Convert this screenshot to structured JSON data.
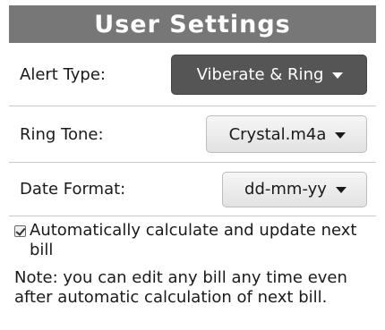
{
  "header": {
    "title": "User Settings"
  },
  "settings": {
    "alert_type": {
      "label": "Alert Type:",
      "value": "Viberate & Ring"
    },
    "ring_tone": {
      "label": "Ring Tone:",
      "value": "Crystal.m4a"
    },
    "date_format": {
      "label": "Date Format:",
      "value": "dd-mm-yy"
    }
  },
  "auto_calculate": {
    "checked": true,
    "label": "Automatically calculate and update next bill"
  },
  "note": {
    "text": "Note: you can edit any bill any time even after automatic calculation of next bill."
  },
  "colors": {
    "title_bar": "#777777",
    "dark_dropdown": "#555555",
    "light_dropdown": "#eeeeee"
  },
  "icons": {
    "dropdown": "chevron-down-icon",
    "checkbox": "checkmark-icon"
  }
}
